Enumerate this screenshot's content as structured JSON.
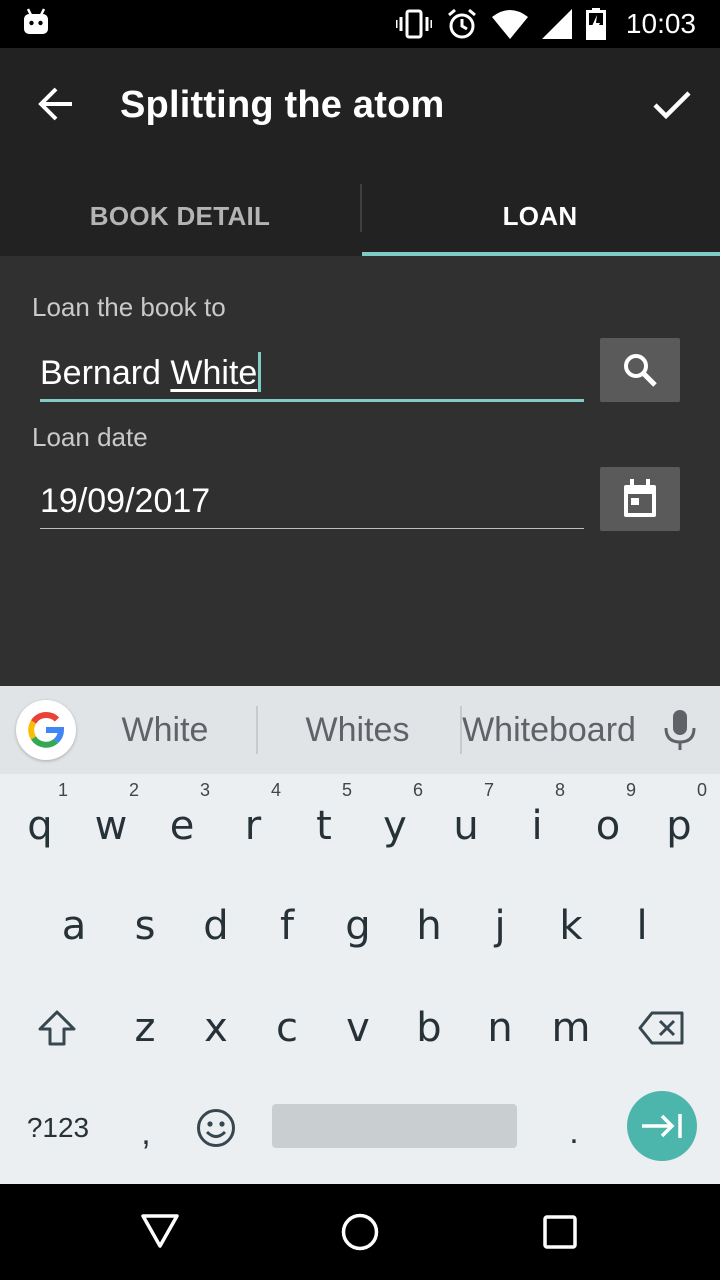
{
  "status_bar": {
    "time": "10:03",
    "icons": [
      "android-icon",
      "vibrate-icon",
      "alarm-icon",
      "wifi-icon",
      "signal-icon",
      "battery-charging-icon"
    ]
  },
  "app_bar": {
    "title": "Splitting the atom",
    "back_icon": "arrow-back-icon",
    "confirm_icon": "check-icon"
  },
  "tabs": [
    {
      "label": "BOOK DETAIL",
      "active": false
    },
    {
      "label": "LOAN",
      "active": true
    }
  ],
  "form": {
    "loan_to_label": "Loan the book to",
    "loan_to_first": "Bernard ",
    "loan_to_composing": "White",
    "loan_date_label": "Loan date",
    "loan_date_value": "19/09/2017"
  },
  "keyboard": {
    "suggestions": [
      "White",
      "Whites",
      "Whiteboard"
    ],
    "row1": [
      "q",
      "w",
      "e",
      "r",
      "t",
      "y",
      "u",
      "i",
      "o",
      "p"
    ],
    "row1_hints": [
      "1",
      "2",
      "3",
      "4",
      "5",
      "6",
      "7",
      "8",
      "9",
      "0"
    ],
    "row2": [
      "a",
      "s",
      "d",
      "f",
      "g",
      "h",
      "j",
      "k",
      "l"
    ],
    "row3": [
      "z",
      "x",
      "c",
      "v",
      "b",
      "n",
      "m"
    ],
    "symbols_label": "?123",
    "comma": ",",
    "period": "."
  },
  "colors": {
    "accent": "#80cbc4",
    "app_bar": "#222222",
    "content_bg": "#303030",
    "enter_key": "#4db6ac"
  }
}
